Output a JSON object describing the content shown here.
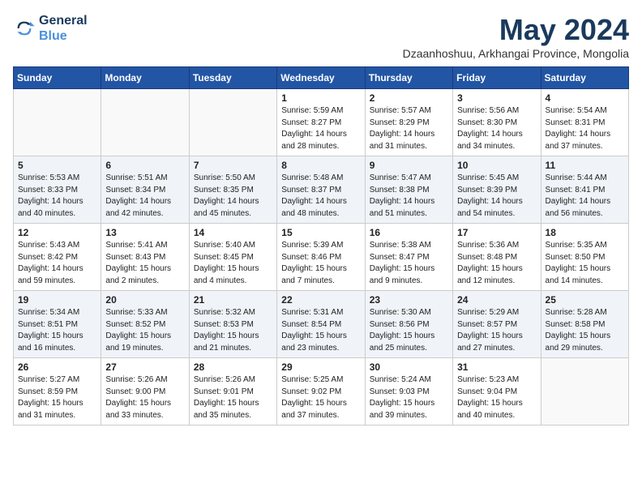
{
  "logo": {
    "line1": "General",
    "line2": "Blue"
  },
  "title": "May 2024",
  "subtitle": "Dzaanhoshuu, Arkhangai Province, Mongolia",
  "weekdays": [
    "Sunday",
    "Monday",
    "Tuesday",
    "Wednesday",
    "Thursday",
    "Friday",
    "Saturday"
  ],
  "weeks": [
    [
      {
        "day": "",
        "info": ""
      },
      {
        "day": "",
        "info": ""
      },
      {
        "day": "",
        "info": ""
      },
      {
        "day": "1",
        "info": "Sunrise: 5:59 AM\nSunset: 8:27 PM\nDaylight: 14 hours\nand 28 minutes."
      },
      {
        "day": "2",
        "info": "Sunrise: 5:57 AM\nSunset: 8:29 PM\nDaylight: 14 hours\nand 31 minutes."
      },
      {
        "day": "3",
        "info": "Sunrise: 5:56 AM\nSunset: 8:30 PM\nDaylight: 14 hours\nand 34 minutes."
      },
      {
        "day": "4",
        "info": "Sunrise: 5:54 AM\nSunset: 8:31 PM\nDaylight: 14 hours\nand 37 minutes."
      }
    ],
    [
      {
        "day": "5",
        "info": "Sunrise: 5:53 AM\nSunset: 8:33 PM\nDaylight: 14 hours\nand 40 minutes."
      },
      {
        "day": "6",
        "info": "Sunrise: 5:51 AM\nSunset: 8:34 PM\nDaylight: 14 hours\nand 42 minutes."
      },
      {
        "day": "7",
        "info": "Sunrise: 5:50 AM\nSunset: 8:35 PM\nDaylight: 14 hours\nand 45 minutes."
      },
      {
        "day": "8",
        "info": "Sunrise: 5:48 AM\nSunset: 8:37 PM\nDaylight: 14 hours\nand 48 minutes."
      },
      {
        "day": "9",
        "info": "Sunrise: 5:47 AM\nSunset: 8:38 PM\nDaylight: 14 hours\nand 51 minutes."
      },
      {
        "day": "10",
        "info": "Sunrise: 5:45 AM\nSunset: 8:39 PM\nDaylight: 14 hours\nand 54 minutes."
      },
      {
        "day": "11",
        "info": "Sunrise: 5:44 AM\nSunset: 8:41 PM\nDaylight: 14 hours\nand 56 minutes."
      }
    ],
    [
      {
        "day": "12",
        "info": "Sunrise: 5:43 AM\nSunset: 8:42 PM\nDaylight: 14 hours\nand 59 minutes."
      },
      {
        "day": "13",
        "info": "Sunrise: 5:41 AM\nSunset: 8:43 PM\nDaylight: 15 hours\nand 2 minutes."
      },
      {
        "day": "14",
        "info": "Sunrise: 5:40 AM\nSunset: 8:45 PM\nDaylight: 15 hours\nand 4 minutes."
      },
      {
        "day": "15",
        "info": "Sunrise: 5:39 AM\nSunset: 8:46 PM\nDaylight: 15 hours\nand 7 minutes."
      },
      {
        "day": "16",
        "info": "Sunrise: 5:38 AM\nSunset: 8:47 PM\nDaylight: 15 hours\nand 9 minutes."
      },
      {
        "day": "17",
        "info": "Sunrise: 5:36 AM\nSunset: 8:48 PM\nDaylight: 15 hours\nand 12 minutes."
      },
      {
        "day": "18",
        "info": "Sunrise: 5:35 AM\nSunset: 8:50 PM\nDaylight: 15 hours\nand 14 minutes."
      }
    ],
    [
      {
        "day": "19",
        "info": "Sunrise: 5:34 AM\nSunset: 8:51 PM\nDaylight: 15 hours\nand 16 minutes."
      },
      {
        "day": "20",
        "info": "Sunrise: 5:33 AM\nSunset: 8:52 PM\nDaylight: 15 hours\nand 19 minutes."
      },
      {
        "day": "21",
        "info": "Sunrise: 5:32 AM\nSunset: 8:53 PM\nDaylight: 15 hours\nand 21 minutes."
      },
      {
        "day": "22",
        "info": "Sunrise: 5:31 AM\nSunset: 8:54 PM\nDaylight: 15 hours\nand 23 minutes."
      },
      {
        "day": "23",
        "info": "Sunrise: 5:30 AM\nSunset: 8:56 PM\nDaylight: 15 hours\nand 25 minutes."
      },
      {
        "day": "24",
        "info": "Sunrise: 5:29 AM\nSunset: 8:57 PM\nDaylight: 15 hours\nand 27 minutes."
      },
      {
        "day": "25",
        "info": "Sunrise: 5:28 AM\nSunset: 8:58 PM\nDaylight: 15 hours\nand 29 minutes."
      }
    ],
    [
      {
        "day": "26",
        "info": "Sunrise: 5:27 AM\nSunset: 8:59 PM\nDaylight: 15 hours\nand 31 minutes."
      },
      {
        "day": "27",
        "info": "Sunrise: 5:26 AM\nSunset: 9:00 PM\nDaylight: 15 hours\nand 33 minutes."
      },
      {
        "day": "28",
        "info": "Sunrise: 5:26 AM\nSunset: 9:01 PM\nDaylight: 15 hours\nand 35 minutes."
      },
      {
        "day": "29",
        "info": "Sunrise: 5:25 AM\nSunset: 9:02 PM\nDaylight: 15 hours\nand 37 minutes."
      },
      {
        "day": "30",
        "info": "Sunrise: 5:24 AM\nSunset: 9:03 PM\nDaylight: 15 hours\nand 39 minutes."
      },
      {
        "day": "31",
        "info": "Sunrise: 5:23 AM\nSunset: 9:04 PM\nDaylight: 15 hours\nand 40 minutes."
      },
      {
        "day": "",
        "info": ""
      }
    ]
  ]
}
